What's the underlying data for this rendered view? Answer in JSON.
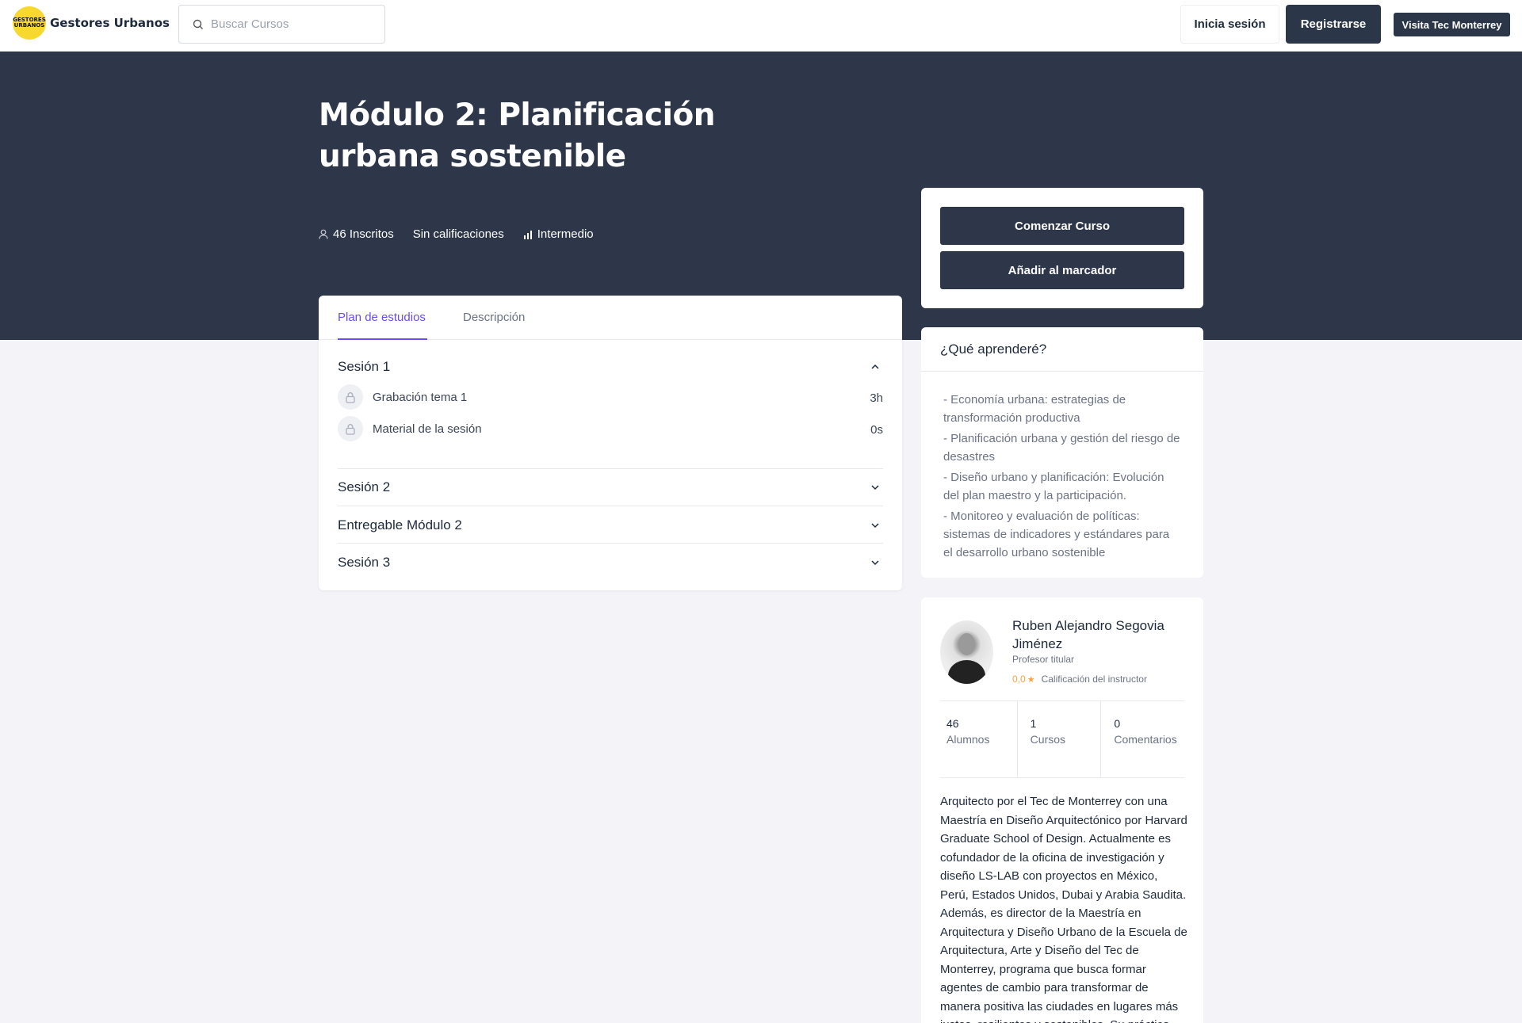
{
  "header": {
    "logo_badge": "GESTORES URBANOS",
    "logo_text": "Gestores Urbanos",
    "search_placeholder": "Buscar Cursos",
    "login_label": "Inicia sesión",
    "register_label": "Registrarse",
    "tec_label": "Visita Tec Monterrey"
  },
  "course": {
    "title": "Módulo 2: Planificación urbana sostenible",
    "enrolled": "46 Inscritos",
    "rating": "Sin calificaciones",
    "level": "Intermedio"
  },
  "tabs": [
    {
      "label": "Plan de estudios",
      "active": true
    },
    {
      "label": "Descripción",
      "active": false
    }
  ],
  "sessions": [
    {
      "title": "Sesión 1",
      "expanded": true,
      "lessons": [
        {
          "title": "Grabación tema 1",
          "duration": "3h"
        },
        {
          "title": "Material de la sesión",
          "duration": "0s"
        }
      ]
    },
    {
      "title": "Sesión 2",
      "expanded": false
    },
    {
      "title": "Entregable Módulo 2",
      "expanded": false
    },
    {
      "title": "Sesión 3",
      "expanded": false
    }
  ],
  "cta": {
    "start_label": "Comenzar Curso",
    "bookmark_label": "Añadir al marcador"
  },
  "learn": {
    "heading": "¿Qué aprenderé?",
    "items": [
      "- Economía urbana: estrategias de transformación productiva",
      "- Planificación urbana y gestión del riesgo de desastres",
      "- Diseño urbano y planificación: Evolución del plan maestro y la participación.",
      "- Monitoreo y evaluación de políticas: sistemas de indicadores y estándares para el desarrollo urbano sostenible"
    ]
  },
  "instructor": {
    "name": "Ruben Alejandro Segovia Jiménez",
    "role": "Profesor titular",
    "score": "0,0",
    "rating_label": "Calificación del instructor",
    "stats": [
      {
        "num": "46",
        "label": "Alumnos"
      },
      {
        "num": "1",
        "label": "Cursos"
      },
      {
        "num": "0",
        "label": "Comentarios"
      }
    ],
    "bio": "Arquitecto por el Tec de Monterrey con una Maestría en Diseño Arquitectónico por Harvard Graduate School of Design. Actualmente es cofundador de la oficina de investigación y diseño LS-LAB con proyectos en México, Perú, Estados Unidos, Dubai y Arabia Saudita. Además, es director de la Maestría en Arquitectura y Diseño Urbano de la Escuela de Arquitectura, Arte y Diseño del Tec de Monterrey, programa que busca formar agentes de cambio para transformar de manera positiva las ciudades en lugares más justos, resilientes y sostenibles. Su práctica"
  },
  "colors": {
    "hero_bg": "#2e3649",
    "accent": "#6a4cf0",
    "star": "#f6a344",
    "logo_yellow": "#f6d82e"
  }
}
